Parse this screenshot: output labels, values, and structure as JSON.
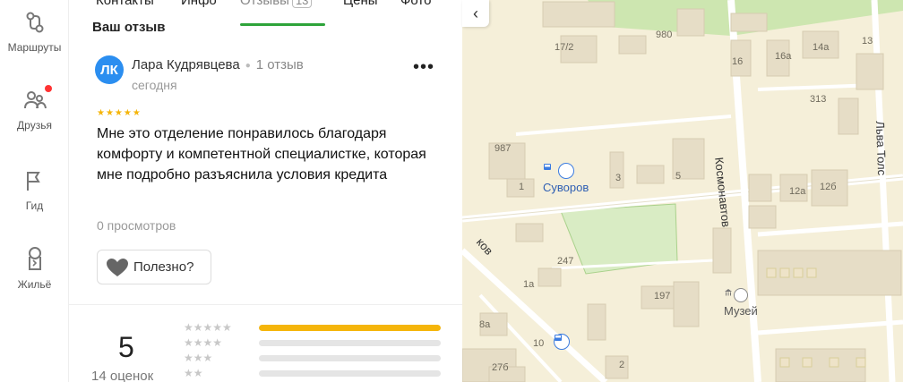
{
  "rail": {
    "routes_label": "Маршруты",
    "friends_label": "Друзья",
    "guide_label": "Гид",
    "housing_label": "Жильё"
  },
  "tabs": {
    "contacts": "Контакты",
    "info": "Инфо",
    "reviews": "Отзывы",
    "reviews_count": "13",
    "prices": "Цены",
    "photos": "Фото"
  },
  "section_title": "Ваш отзыв",
  "review": {
    "avatar_initials": "ЛК",
    "author": "Лара Кудрявцева",
    "author_reviews": "1 отзыв",
    "date": "сегодня",
    "rating": 5,
    "text": "Мне это отделение понравилось благодаря комфорту и компетентной специалистке, которая мне подробно разъяснила условия кредита",
    "views": "0 просмотров",
    "useful_label": "Полезно?"
  },
  "summary": {
    "rating": "5",
    "count_label": "14 оценок",
    "distribution": [
      {
        "stars": 5,
        "fraction": 1.0
      },
      {
        "stars": 4,
        "fraction": 0.0
      },
      {
        "stars": 3,
        "fraction": 0.0
      },
      {
        "stars": 2,
        "fraction": 0.0
      }
    ]
  },
  "map": {
    "bus_stop_1": "Суворов",
    "museum": "Музей",
    "street_1": "Космонавтов",
    "street_2": "Льва Толс",
    "street_3": "ков",
    "labels": [
      "980",
      "17/2",
      "16",
      "16а",
      "14а",
      "13",
      "313",
      "987",
      "1",
      "3",
      "5",
      "12а",
      "12б",
      "247",
      "1а",
      "197",
      "8а",
      "10",
      "27б",
      "2"
    ]
  }
}
